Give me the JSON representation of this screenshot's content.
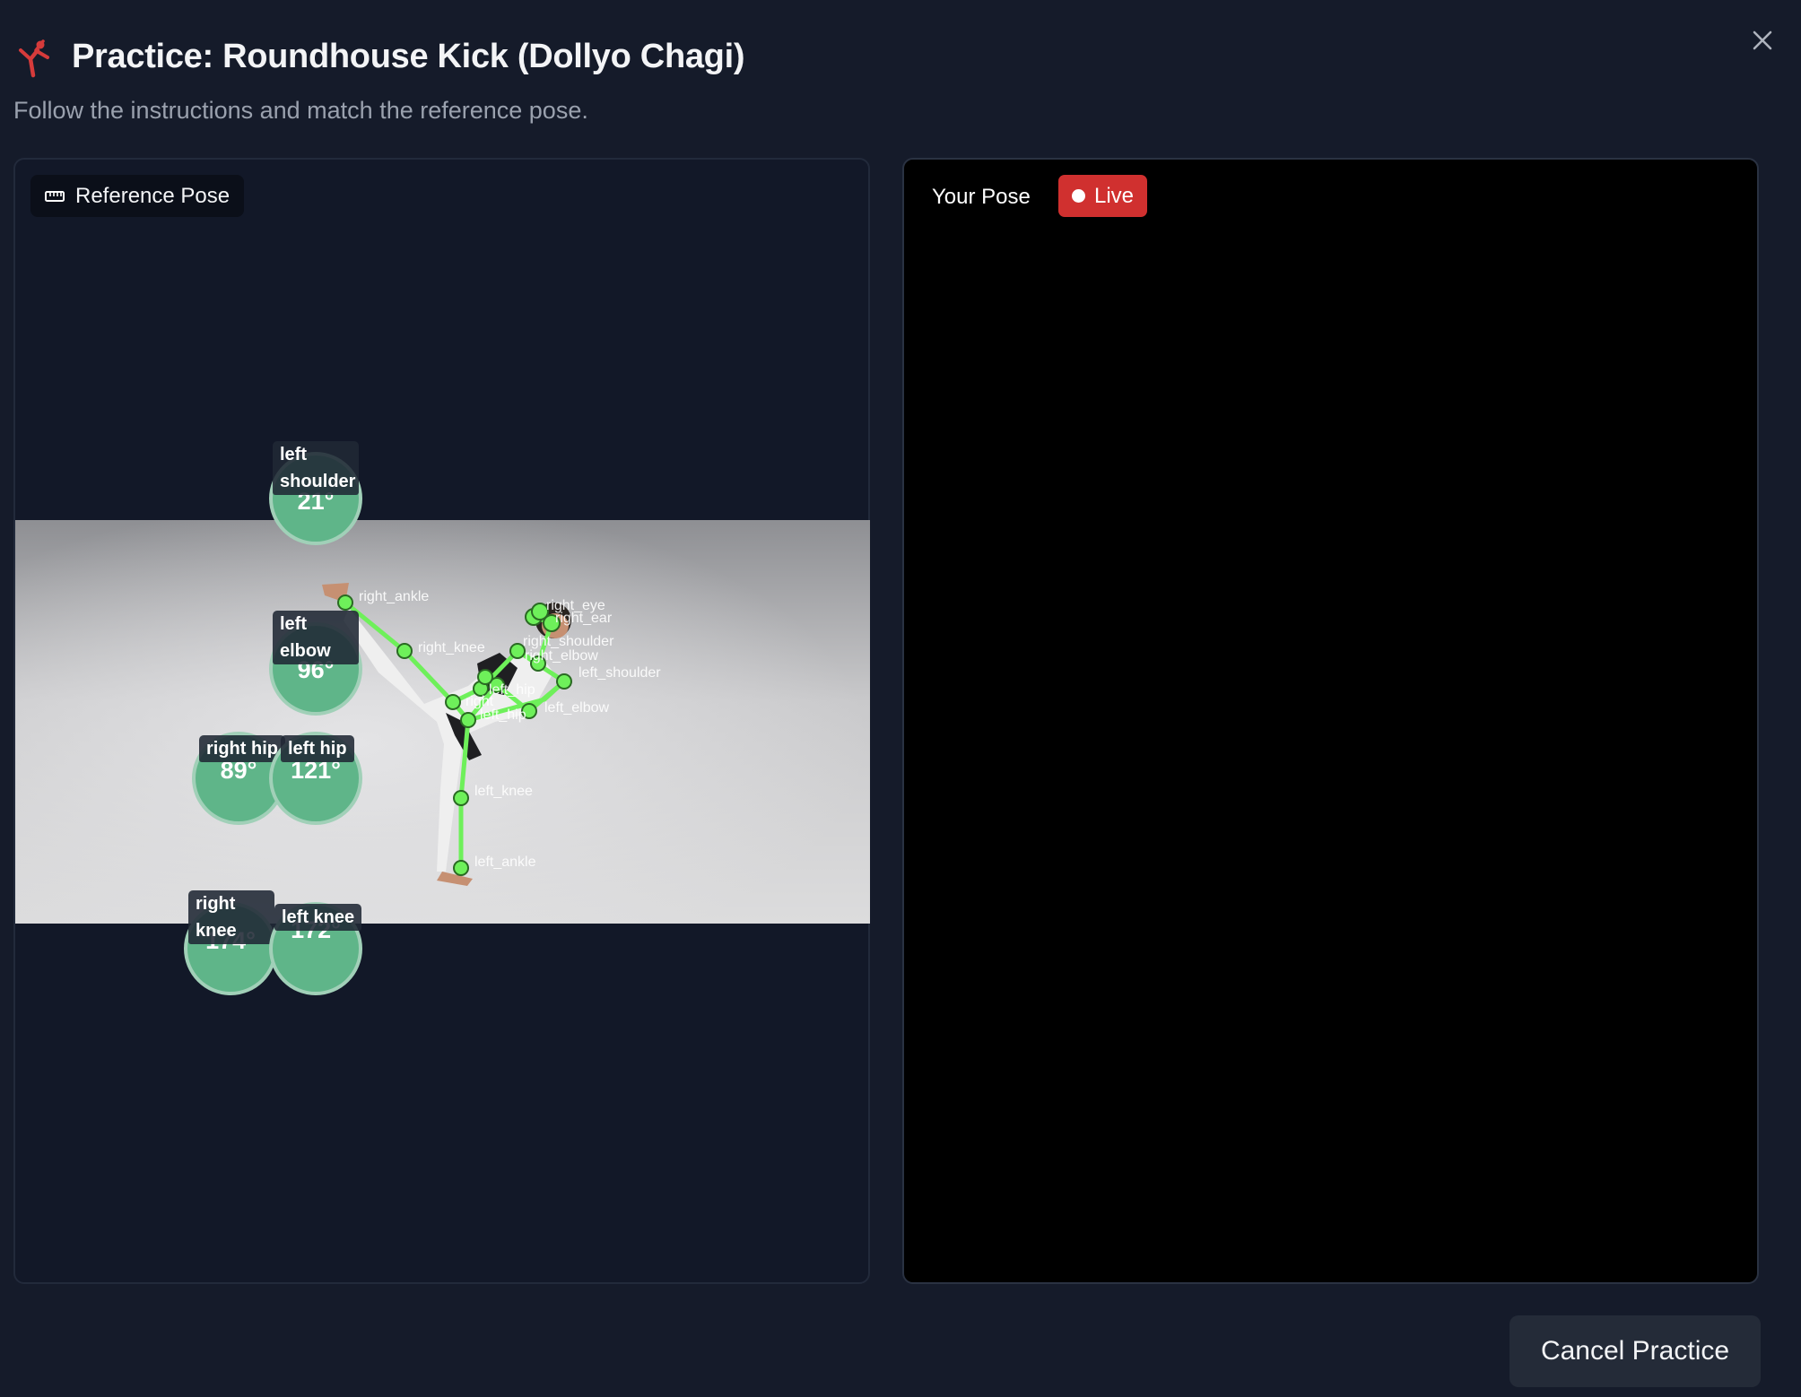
{
  "header": {
    "title": "Practice: Roundhouse Kick (Dollyo Chagi)",
    "subtitle": "Follow the instructions and match the reference pose.",
    "icon": "martial-arts-kick-icon",
    "icon_color": "#d63b3b"
  },
  "reference_panel": {
    "badge_label": "Reference Pose",
    "badge_icon": "ruler-icon",
    "keypoint_labels": [
      "right_ankle",
      "right_knee",
      "right_eye",
      "right_ear",
      "right_shoulder",
      "right_elbow",
      "left_shoulder",
      "left_elbow",
      "left_knee",
      "left_ankle",
      "right",
      "left_hip",
      "left_hip"
    ],
    "skeleton_color": "#6ef05a"
  },
  "joints": [
    {
      "label": "left shoulder",
      "angle": "21°"
    },
    {
      "label": "left elbow",
      "angle": "96°"
    },
    {
      "label": "right hip",
      "angle": "89°"
    },
    {
      "label": "left hip",
      "angle": "121°"
    },
    {
      "label": "right knee",
      "angle": "174°"
    },
    {
      "label": "left knee",
      "angle": "172°"
    }
  ],
  "live_panel": {
    "label": "Your Pose",
    "live_badge": "Live",
    "live_color": "#d0302f"
  },
  "footer": {
    "cancel_label": "Cancel Practice"
  }
}
